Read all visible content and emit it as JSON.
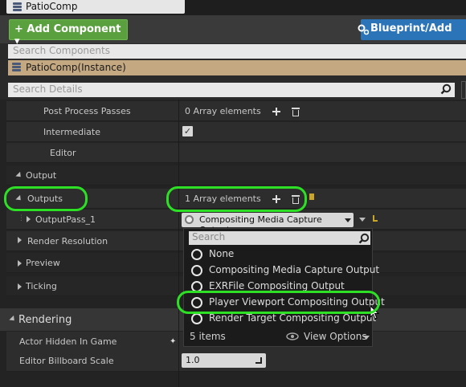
{
  "top": {
    "component_tab": "PatioComp"
  },
  "toolbar": {
    "add_component": "+ Add Component ▾",
    "blueprint_add": "Blueprint/Add"
  },
  "components": {
    "search_placeholder": "Search Components",
    "instance_label": "PatioComp(Instance)"
  },
  "details": {
    "search_placeholder": "Search Details",
    "rows": {
      "post_process_passes": {
        "label": "Post Process Passes",
        "value": "0 Array elements"
      },
      "intermediate": {
        "label": "Intermediate"
      },
      "editor": {
        "label": "Editor"
      },
      "output_category": {
        "label": "Output"
      },
      "outputs": {
        "label": "Outputs",
        "value": "1 Array elements"
      },
      "output_pass": {
        "label": "OutputPass_1",
        "value": "Compositing Media Capture Output"
      },
      "render_resolution": {
        "label": "Render Resolution"
      },
      "preview": {
        "label": "Preview"
      },
      "ticking": {
        "label": "Ticking"
      },
      "rendering": {
        "label": "Rendering"
      },
      "actor_hidden": {
        "label": "Actor Hidden In Game"
      },
      "billboard_scale": {
        "label": "Editor Billboard Scale",
        "value": "1.0"
      }
    }
  },
  "popup": {
    "search_placeholder": "Search",
    "items": [
      "None",
      "Compositing Media Capture Output",
      "EXRFile Compositing Output",
      "Player Viewport Compositing Output",
      "Render Target Compositing Output"
    ],
    "count": "5 items",
    "view_options": "View Options"
  },
  "colors": {
    "highlight": "#2de025",
    "add_button": "#5aa03f",
    "blueprint_button": "#2c74b8",
    "instance_row": "#c4a882"
  }
}
